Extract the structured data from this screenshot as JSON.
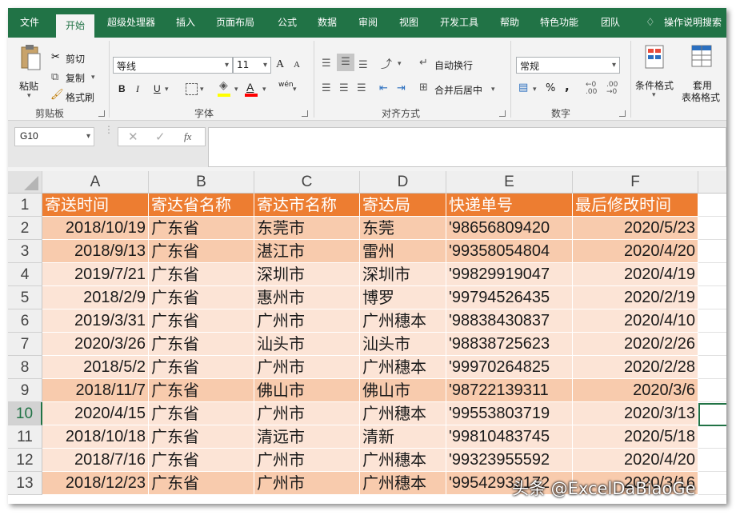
{
  "ribbon_tabs": [
    {
      "label": "文件"
    },
    {
      "label": "开始"
    },
    {
      "label": "超级处理器"
    },
    {
      "label": "插入"
    },
    {
      "label": "页面布局"
    },
    {
      "label": "公式"
    },
    {
      "label": "数据"
    },
    {
      "label": "审阅"
    },
    {
      "label": "视图"
    },
    {
      "label": "开发工具"
    },
    {
      "label": "帮助"
    },
    {
      "label": "特色功能"
    },
    {
      "label": "团队"
    },
    {
      "label": "操作说明搜索"
    }
  ],
  "clipboard": {
    "paste": "粘贴",
    "cut": "剪切",
    "copy": "复制",
    "format_painter": "格式刷",
    "group": "剪贴板"
  },
  "font": {
    "name": "等线",
    "size": "11",
    "grow": "A",
    "shrink": "A",
    "bold": "B",
    "italic": "I",
    "underline": "U",
    "font_color_glyph": "A",
    "phonetic": "wén",
    "group": "字体"
  },
  "alignment": {
    "wrap_text": "自动换行",
    "merge_center": "合并后居中",
    "group": "对齐方式"
  },
  "number": {
    "format": "常规",
    "percent": "%",
    "comma": ",",
    "group": "数字"
  },
  "styles": {
    "conditional_format": "条件格式",
    "table_format_1": "套用",
    "table_format_2": "表格格式"
  },
  "formula_bar": {
    "name_box": "G10",
    "fx": "fx",
    "value": ""
  },
  "columns": [
    "A",
    "B",
    "C",
    "D",
    "E",
    "F"
  ],
  "rows": [
    {
      "n": "1",
      "cells": [
        "寄送时间",
        "寄达省名称",
        "寄达市名称",
        "寄达局",
        "快递单号",
        "最后修改时间"
      ]
    },
    {
      "n": "2",
      "cells": [
        "2018/10/19",
        "广东省",
        "东莞市",
        "东莞",
        "'98656809420",
        "2020/5/23"
      ]
    },
    {
      "n": "3",
      "cells": [
        "2018/9/13",
        "广东省",
        "湛江市",
        "雷州",
        "'99358054804",
        "2020/4/20"
      ]
    },
    {
      "n": "4",
      "cells": [
        "2019/7/21",
        "广东省",
        "深圳市",
        "深圳市",
        "'99829919047",
        "2020/4/19"
      ]
    },
    {
      "n": "5",
      "cells": [
        "2018/2/9",
        "广东省",
        "惠州市",
        "博罗",
        "'99794526435",
        "2020/2/19"
      ]
    },
    {
      "n": "6",
      "cells": [
        "2019/3/31",
        "广东省",
        "广州市",
        "广州穗本",
        "'98838430837",
        "2020/4/10"
      ]
    },
    {
      "n": "7",
      "cells": [
        "2020/3/26",
        "广东省",
        "汕头市",
        "汕头市",
        "'98838725623",
        "2020/2/26"
      ]
    },
    {
      "n": "8",
      "cells": [
        "2018/5/2",
        "广东省",
        "广州市",
        "广州穗本",
        "'99970264825",
        "2020/2/28"
      ]
    },
    {
      "n": "9",
      "cells": [
        "2018/11/7",
        "广东省",
        "佛山市",
        "佛山市",
        "'98722139311",
        "2020/3/6"
      ]
    },
    {
      "n": "10",
      "cells": [
        "2020/4/15",
        "广东省",
        "广州市",
        "广州穗本",
        "'99553803719",
        "2020/3/13"
      ]
    },
    {
      "n": "11",
      "cells": [
        "2018/10/18",
        "广东省",
        "清远市",
        "清新",
        "'99810483745",
        "2020/5/18"
      ]
    },
    {
      "n": "12",
      "cells": [
        "2018/7/16",
        "广东省",
        "广州市",
        "广州穗本",
        "'99323955592",
        "2020/4/20"
      ]
    },
    {
      "n": "13",
      "cells": [
        "2018/12/23",
        "广东省",
        "广州市",
        "广州穗本",
        "'99542932172",
        "2020/3/16"
      ]
    }
  ],
  "row_colors": [
    "#ed7d31",
    "#f8cbad",
    "#f8cbad",
    "#fce4d6",
    "#fce4d6",
    "#fce4d6",
    "#fce4d6",
    "#fce4d6",
    "#f8cbad",
    "#fce4d6",
    "#fce4d6",
    "#fce4d6",
    "#f8cbad"
  ],
  "colors": {
    "ribbon_green": "#217346",
    "header_orange": "#ed7d31",
    "active_row_header": "#217346"
  },
  "watermark": "头条 @ExcelDaBiaoGe"
}
